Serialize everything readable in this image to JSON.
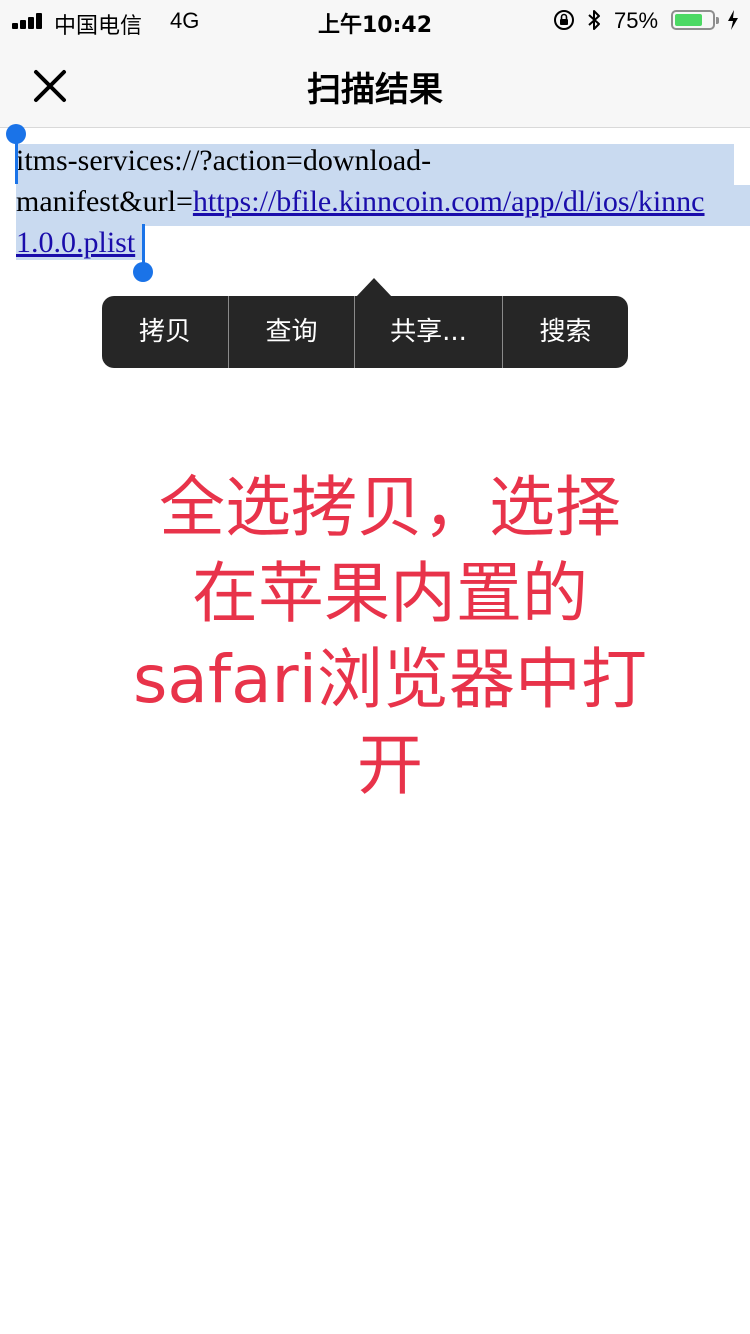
{
  "status_bar": {
    "carrier": "中国电信",
    "network": "4G",
    "time": "上午10:42",
    "battery_percent": "75%",
    "battery_level": 0.75,
    "icons": [
      "signal-icon",
      "orientation-lock-icon",
      "bluetooth-icon",
      "battery-icon",
      "charging-icon"
    ]
  },
  "nav": {
    "title": "扫描结果",
    "close_icon": "close-icon"
  },
  "scan_result": {
    "line1": "itms-services://?action=download-",
    "line2_prefix": "manifest&url=",
    "line2_link": "https://bfile.kinncoin.com/app/dl/ios/kinnc",
    "line3_link": "1.0.0.plist",
    "selected": true
  },
  "edit_menu": {
    "items": [
      "拷贝",
      "查询",
      "共享...",
      "搜索"
    ]
  },
  "annotation": {
    "lines": [
      "全选拷贝，选择",
      "在苹果内置的",
      "safari浏览器中打",
      "开"
    ],
    "color": "#e8334a"
  },
  "colors": {
    "selection": "#c9daf0",
    "handle": "#1a73e8",
    "link": "#1a0dab",
    "menu_bg": "#262626",
    "bar_bg": "#f7f7f7"
  }
}
